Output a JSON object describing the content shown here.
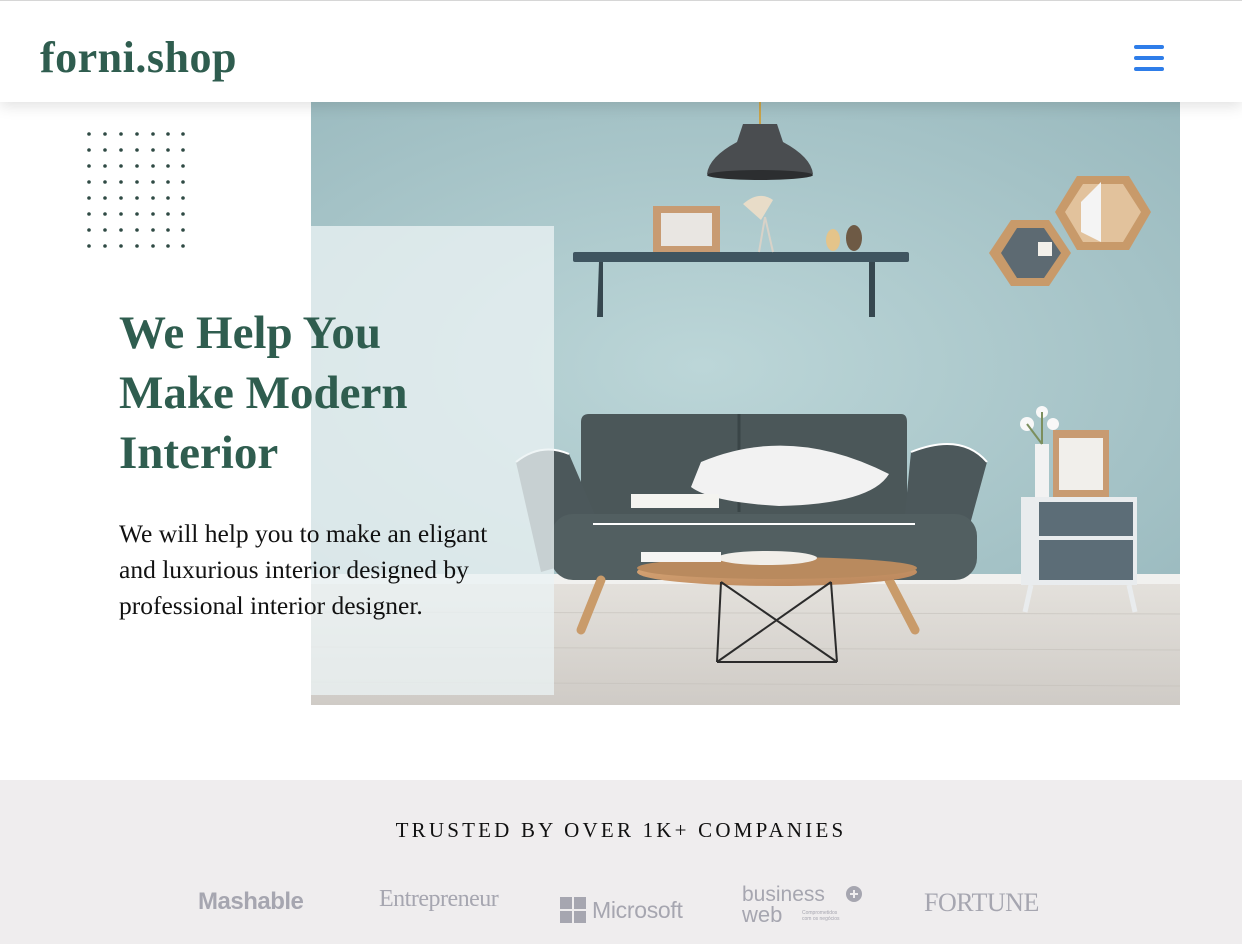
{
  "header": {
    "logo": "forni.shop",
    "menu_icon": "hamburger-menu-icon"
  },
  "hero": {
    "title_lines": [
      "We Help You",
      "Make Modern",
      "Interior"
    ],
    "subtitle_lines": [
      "We will help you to make an eligant",
      "and luxurious interior designed by",
      "professional interior designer."
    ],
    "image_icon": "living-room-photo"
  },
  "trusted": {
    "title": "TRUSTED BY OVER 1K+ COMPANIES",
    "brands": {
      "mashable": "Mashable",
      "entrepreneur": "Entrepreneur",
      "microsoft": "Microsoft",
      "business_web_top": "business",
      "business_web_bottom": "web",
      "business_web_tagline_1": "Comprometidos",
      "business_web_tagline_2": "com os negócios",
      "fortune": "FORTUNE"
    }
  },
  "colors": {
    "brand_green": "#2f5d4f",
    "menu_blue": "#2e7de9",
    "wall": "#a3c2c6",
    "logo_gray": "#a6a6b0",
    "trusted_bg": "#efedee"
  }
}
